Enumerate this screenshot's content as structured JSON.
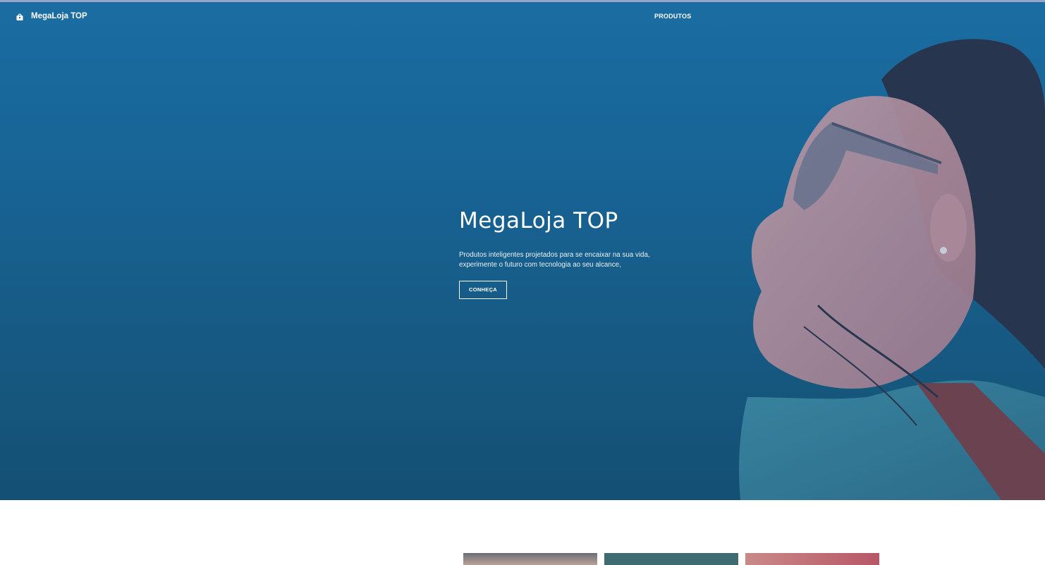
{
  "navbar": {
    "brand_label": "MegaLoja TOP",
    "brand_icon": "shopping-bag-icon",
    "links": [
      {
        "label": "PRODUTOS"
      }
    ]
  },
  "hero": {
    "title": "MegaLoja TOP",
    "description": "Produtos inteligentes projetados para se encaixar na sua vida, experimente o futuro com tecnologia ao seu alcance,",
    "cta_label": "CONHEÇA"
  },
  "colors": {
    "hero_overlay": "#176190",
    "text": "#ffffff",
    "top_strip": "#9aa6c8"
  }
}
